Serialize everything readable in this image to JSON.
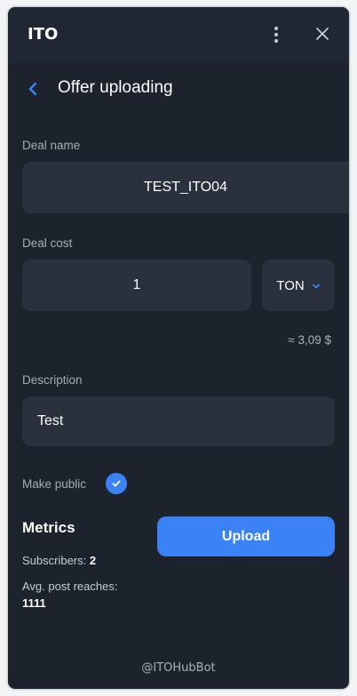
{
  "app": {
    "title": "ITO"
  },
  "header": {
    "title": "Offer uploading"
  },
  "form": {
    "deal_name_label": "Deal name",
    "deal_name_value": "TEST_ITO04",
    "deal_cost_label": "Deal cost",
    "deal_cost_value": "1",
    "currency": "TON",
    "converted": "≈ 3,09 $",
    "description_label": "Description",
    "description_value": "Test",
    "make_public_label": "Make public",
    "make_public_checked": true
  },
  "metrics": {
    "title": "Metrics",
    "subscribers_label": "Subscribers:",
    "subscribers_value": "2",
    "reaches_label": "Avg. post reaches:",
    "reaches_value": "1111"
  },
  "upload_label": "Upload",
  "footer": "@ITOHubBot",
  "colors": {
    "accent": "#3b82f6",
    "background": "#1c232d",
    "field": "#2a313c"
  },
  "icons": {
    "menu": "kebab-menu-icon",
    "close": "close-icon",
    "back": "chevron-left-icon",
    "dropdown": "chevron-down-icon",
    "check": "checkmark-icon"
  }
}
